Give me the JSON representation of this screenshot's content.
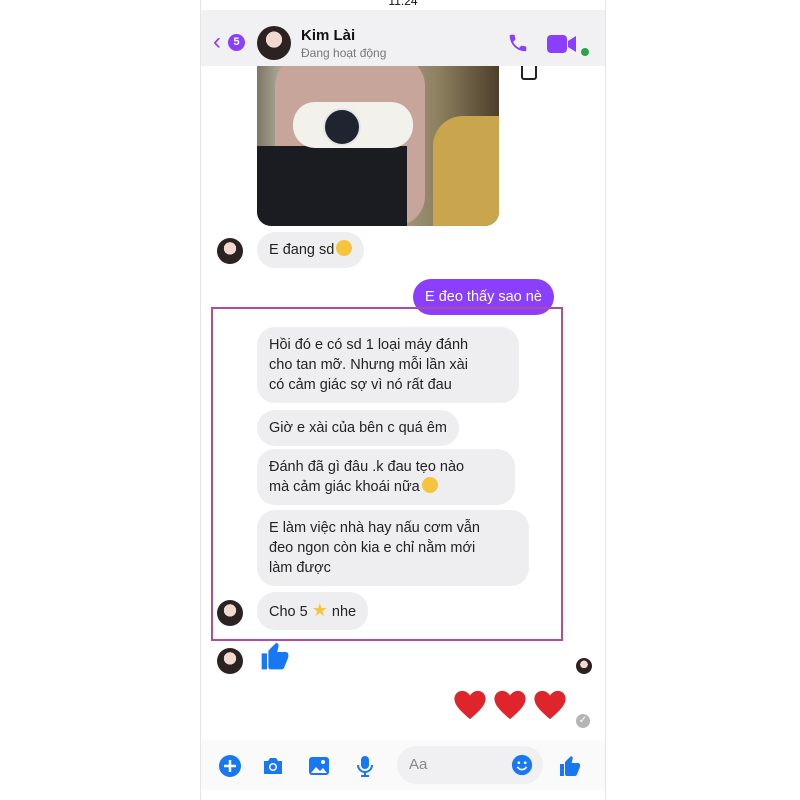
{
  "status_bar": {
    "time": "11:24"
  },
  "header": {
    "back_badge": "5",
    "contact_name": "Kim Lài",
    "contact_status": "Đang hoạt động"
  },
  "messages": [
    {
      "side": "received",
      "text": "E đang sd",
      "emoji": "grinning-sweat-emoji"
    },
    {
      "side": "sent",
      "text": "E đeo thấy sao nè"
    },
    {
      "side": "received",
      "lines": [
        "Hồi đó e có sd 1 loại máy đánh",
        "cho tan mỡ. Nhưng mỗi lần xài",
        "có cảm giác sợ vì nó rất đau"
      ]
    },
    {
      "side": "received",
      "text": "Giờ e xài của bên c quá êm"
    },
    {
      "side": "received",
      "lines": [
        "Đánh đã gì đâu .k đau tẹo nào",
        "mà cảm giác khoái nữa"
      ],
      "emoji": "grinning-sweat-emoji"
    },
    {
      "side": "received",
      "lines": [
        "E làm việc nhà hay nấu cơm vẫn",
        "đeo ngon còn kia e chỉ nằm mới",
        "làm được"
      ]
    },
    {
      "side": "received",
      "text_before": "Cho 5",
      "emoji": "star-emoji",
      "text_after": "nhe"
    }
  ],
  "composer": {
    "placeholder": "Aa"
  },
  "colors": {
    "accent": "#8a3ffc",
    "received_bubble": "#eeeef0",
    "highlight_border": "#b14aa0",
    "heart": "#e0242b",
    "like": "#1877f2"
  },
  "icons": [
    "chevron-left-icon",
    "phone-icon",
    "video-camera-icon",
    "plus-icon",
    "camera-icon",
    "image-icon",
    "microphone-icon",
    "smiley-icon",
    "thumbs-up-icon",
    "heart-icon"
  ]
}
